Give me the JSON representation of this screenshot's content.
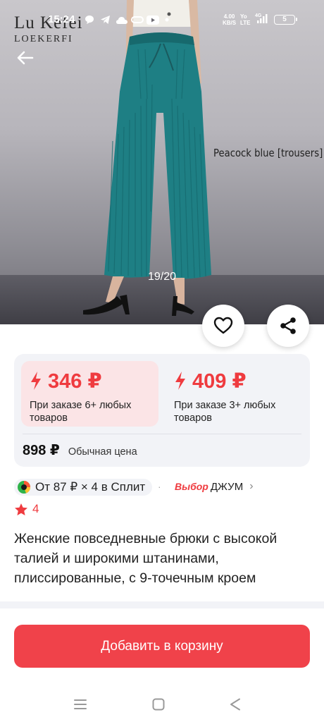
{
  "status_bar": {
    "time": "15:24",
    "network_speed": "4.00",
    "network_unit": "KB/S",
    "volte_top": "Yo",
    "volte_bottom": "LTE",
    "signal_label": "4G",
    "battery": "5",
    "icons": [
      "chat-icon",
      "telegram-icon",
      "cloud-icon",
      "link-icon",
      "youtube-icon",
      "wifi-icon",
      "signal-icon",
      "battery-icon"
    ]
  },
  "gallery": {
    "brand_line1": "Lu Kefei",
    "brand_line2": "LOEKERFI",
    "caption": "Peacock blue [trousers]",
    "counter": "19/20"
  },
  "prices": {
    "tier1_price": "346 ₽",
    "tier1_condition": "При заказе 6+ любых товаров",
    "tier2_price": "409 ₽",
    "tier2_condition": "При заказе 3+ любых товаров",
    "regular_price": "898 ₽",
    "regular_label": "Обычная цена",
    "accent_color": "#ef3b3f"
  },
  "installments": {
    "text": "От 87 ₽ × 4 в Сплит",
    "badge_choice": "Выбор",
    "badge_name": "ДЖУМ"
  },
  "rating": {
    "value": "4"
  },
  "product": {
    "title": "Женские повседневные брюки с высокой талией и широкими штанинами, плиссированные, с 9-точечным кроем"
  },
  "actions": {
    "add_to_cart": "Добавить в корзину",
    "button_color": "#f0424a"
  }
}
